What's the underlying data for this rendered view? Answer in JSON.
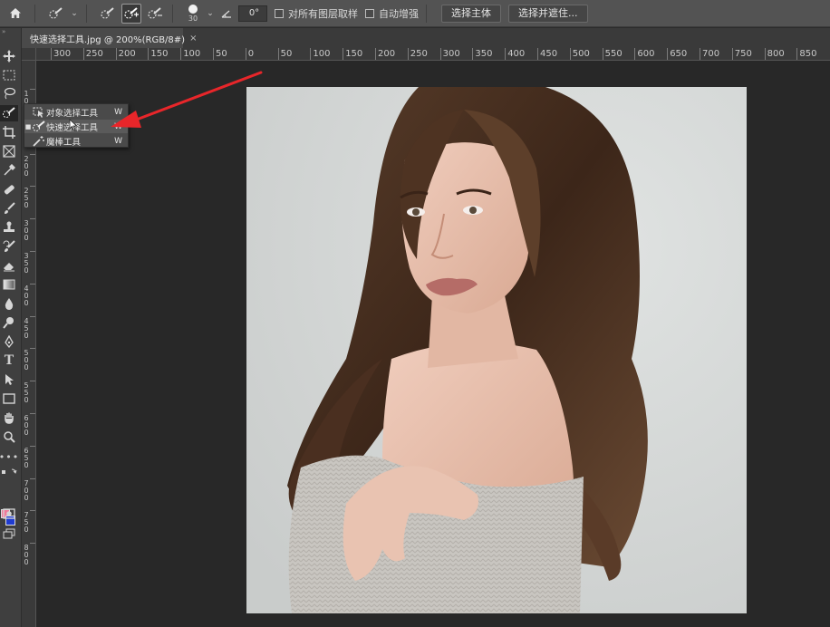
{
  "options_bar": {
    "brush_size": "30",
    "angle_value": "0°",
    "sample_all_layers_label": "对所有图层取样",
    "auto_enhance_label": "自动增强",
    "select_subject_label": "选择主体",
    "select_mask_label": "选择并遮住..."
  },
  "document": {
    "tab_title": "快速选择工具.jpg @ 200%(RGB/8#)",
    "close_glyph": "×"
  },
  "ruler_h": [
    "300",
    "250",
    "200",
    "150",
    "100",
    "50",
    "0",
    "50",
    "100",
    "150",
    "200",
    "250",
    "300",
    "350",
    "400",
    "450",
    "500",
    "550",
    "600",
    "650",
    "700",
    "750",
    "800",
    "850"
  ],
  "ruler_v": [
    "1",
    "0",
    "0",
    "1",
    "5",
    "0",
    "2",
    "0",
    "0",
    "2",
    "5",
    "0",
    "3",
    "0",
    "0",
    "3",
    "5",
    "0",
    "4",
    "0",
    "0",
    "4",
    "5",
    "0",
    "5",
    "0",
    "0",
    "5",
    "5",
    "0",
    "6",
    "0",
    "0",
    "6",
    "5",
    "0",
    "7",
    "0",
    "0",
    "7",
    "5",
    "0",
    "8",
    "0",
    "0"
  ],
  "flyout": {
    "items": [
      {
        "label": "对象选择工具",
        "key": "W",
        "icon": "object-selection-icon"
      },
      {
        "label": "快速选择工具",
        "key": "W",
        "icon": "quick-selection-icon"
      },
      {
        "label": "魔棒工具",
        "key": "W",
        "icon": "magic-wand-icon"
      }
    ]
  },
  "colors": {
    "foreground": "#f07a9a",
    "background": "#1f3bd0",
    "arrow": "#e8262a"
  },
  "toolbar": {
    "tools": [
      "move-tool",
      "marquee-tool",
      "lasso-tool",
      "quick-selection-tool",
      "crop-tool",
      "frame-tool",
      "eyedropper-tool",
      "healing-brush-tool",
      "brush-tool",
      "clone-stamp-tool",
      "history-brush-tool",
      "eraser-tool",
      "gradient-tool",
      "blur-tool",
      "dodge-tool",
      "pen-tool",
      "type-tool",
      "path-selection-tool",
      "rectangle-tool",
      "hand-tool",
      "zoom-tool",
      "more-tools"
    ],
    "type_tool_glyph": "T"
  }
}
